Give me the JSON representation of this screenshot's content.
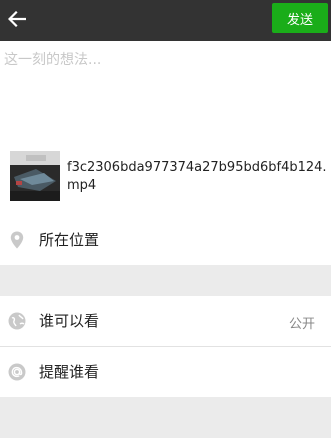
{
  "header": {
    "back_icon": "arrow-left-icon",
    "send_label": "发送",
    "send_color": "#1aad19",
    "bar_color": "#333333"
  },
  "compose": {
    "placeholder": "这一刻的想法..."
  },
  "attachment": {
    "file_name": "f3c2306bda977374a27b95bd6bf4b124.mp4"
  },
  "location": {
    "label": "所在位置",
    "icon": "location-pin-icon"
  },
  "visibility": {
    "label": "谁可以看",
    "value": "公开",
    "icon": "globe-icon"
  },
  "mention": {
    "label": "提醒谁看",
    "icon": "at-sign-icon"
  }
}
